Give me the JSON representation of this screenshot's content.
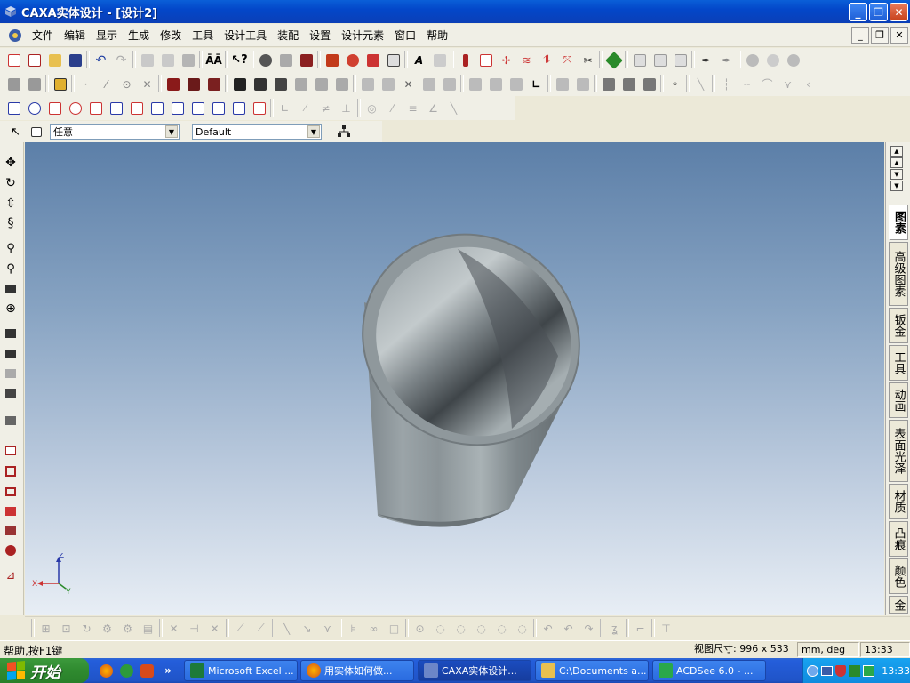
{
  "window": {
    "title": "CAXA实体设计 - [设计2]",
    "buttons": {
      "minimize": "_",
      "restore": "❐",
      "close": "✕"
    }
  },
  "menu": {
    "items": [
      "文件",
      "编辑",
      "显示",
      "生成",
      "修改",
      "工具",
      "设计工具",
      "装配",
      "设置",
      "设计元素",
      "窗口",
      "帮助"
    ],
    "mdi_buttons": {
      "minimize": "_",
      "restore": "❐",
      "close": "✕"
    }
  },
  "selection": {
    "filter_value": "任意",
    "scheme_value": "Default"
  },
  "design_element_tabs": [
    "图素",
    "高级图素",
    "钣金",
    "工具",
    "动画",
    "表面光泽",
    "材质",
    "凸痕",
    "颜色",
    "金"
  ],
  "statusbar": {
    "help_text": "帮助,按F1键",
    "view_size": "视图尺寸: 996 x 533",
    "units": "mm, deg",
    "time": "13:33"
  },
  "axes": {
    "x": "X",
    "y": "Y",
    "z": "Z"
  },
  "taskbar": {
    "start_label": "开始",
    "tasks": [
      {
        "label": "Microsoft Excel ...",
        "icon": "excel-icon"
      },
      {
        "label": "用实体如何做...",
        "icon": "firefox-icon"
      },
      {
        "label": "CAXA实体设计...",
        "icon": "caxa-icon"
      },
      {
        "label": "C:\\Documents a...",
        "icon": "folder-icon"
      },
      {
        "label": "ACDSee 6.0 - ...",
        "icon": "acdsee-icon"
      }
    ],
    "clock": "13:33",
    "expand": "»"
  },
  "colors": {
    "viewport_top": "#5c7fa8",
    "viewport_bottom": "#e8eef5",
    "title_blue": "#0347c9",
    "start_green": "#2f8a2f",
    "part_gray": "#8f989c"
  }
}
